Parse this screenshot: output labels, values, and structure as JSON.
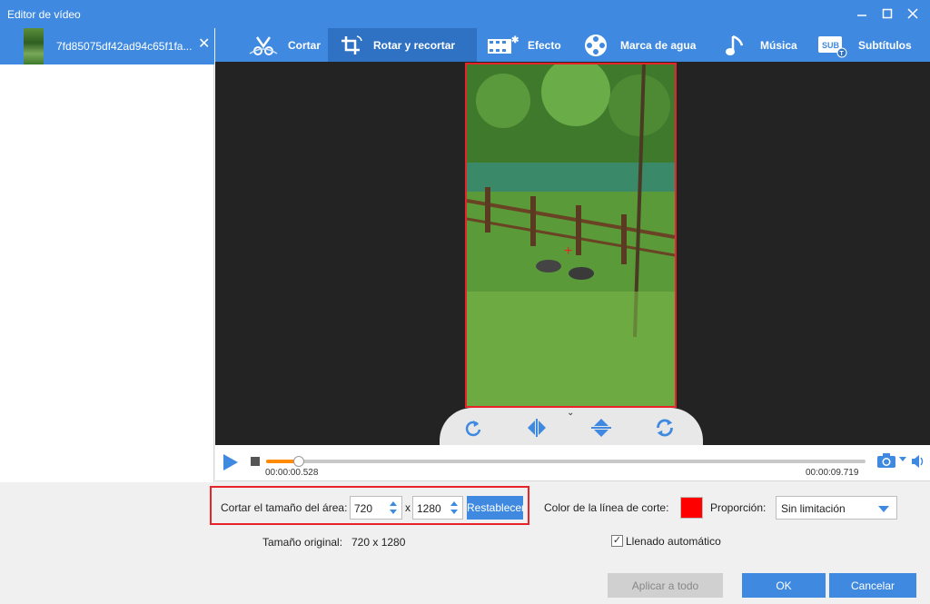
{
  "window": {
    "title": "Editor de vídeo",
    "controls": [
      "minimize-icon",
      "maximize-icon",
      "close-icon"
    ]
  },
  "file_list": {
    "items": [
      {
        "name": "7fd85075df42ad94c65f1fa...",
        "selected": true
      }
    ]
  },
  "tabs": [
    {
      "label": "Cortar",
      "icon": "scissors-icon"
    },
    {
      "label": "Rotar y recortar",
      "icon": "crop-rotate-icon",
      "active": true
    },
    {
      "label": "Efecto",
      "icon": "film-effect-icon"
    },
    {
      "label": "Marca de agua",
      "icon": "film-reel-icon"
    },
    {
      "label": "Música",
      "icon": "music-note-icon"
    },
    {
      "label": "Subtítulos",
      "icon": "subtitle-icon"
    }
  ],
  "rotate_tools": [
    "rotate-clockwise-icon",
    "flip-horizontal-icon",
    "flip-vertical-icon",
    "rotate-refresh-icon"
  ],
  "player": {
    "current_time": "00:00:00.528",
    "end_time": "00:00:09.719",
    "progress": 0.054
  },
  "crop": {
    "area_label": "Cortar el tamaño del área:",
    "width": "720",
    "separator": "x",
    "height": "1280",
    "reset_label": "Restablecer",
    "line_color_label": "Color de la línea de corte:",
    "line_color": "#ff0000",
    "ratio_label": "Proporción:",
    "ratio_value": "Sin limitación",
    "original_label": "Tamaño original:",
    "original_value": "720 x 1280",
    "autofill_label": "Llenado automático",
    "autofill_checked": true
  },
  "footer": {
    "apply_all": "Aplicar a todo",
    "ok": "OK",
    "cancel": "Cancelar"
  },
  "colors": {
    "accent": "#3f8ae0",
    "highlight": "#e8242a",
    "progress": "#ff8a00"
  }
}
